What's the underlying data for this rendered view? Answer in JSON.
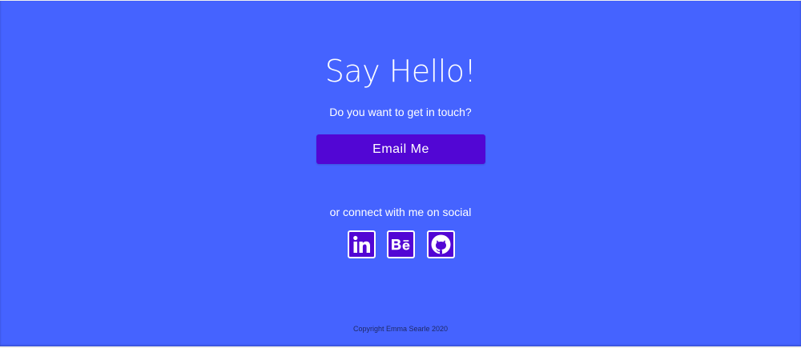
{
  "contact": {
    "title": "Say Hello!",
    "subtitle": "Do you want to get in touch?",
    "email_label": "Email Me",
    "social_prompt": "or connect with me on social"
  },
  "social_links": [
    {
      "name": "LinkedIn",
      "icon": "linkedin-icon"
    },
    {
      "name": "Behance",
      "icon": "behance-icon"
    },
    {
      "name": "GitHub",
      "icon": "github-icon"
    }
  ],
  "footer": {
    "copyright": "Copyright Emma Searle 2020"
  },
  "colors": {
    "background": "#4563ff",
    "button": "#5206d4",
    "text": "#ffffff",
    "footer_text": "#1f2a66"
  }
}
